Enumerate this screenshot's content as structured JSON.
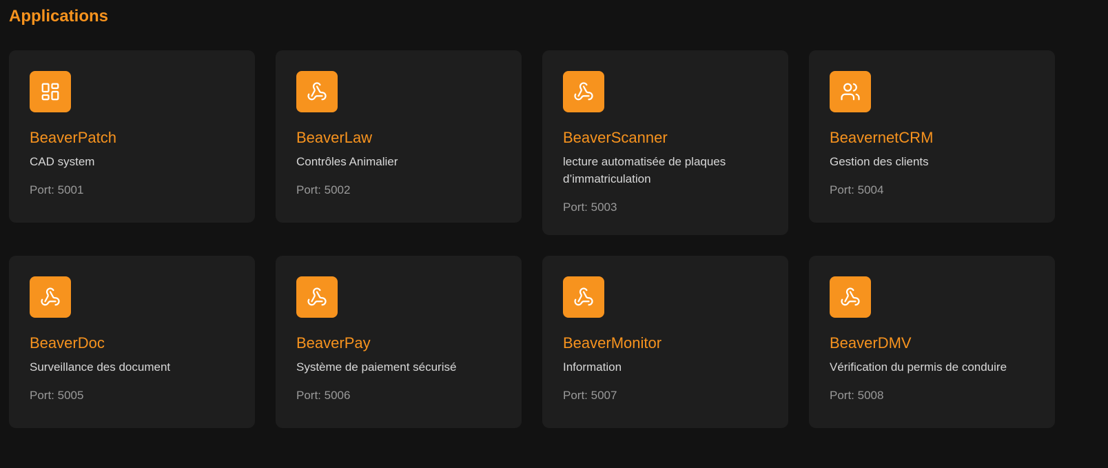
{
  "page": {
    "title": "Applications"
  },
  "colors": {
    "background": "#121212",
    "card": "#1e1e1e",
    "accent": "#f7931e",
    "description": "#d8d8d8",
    "port": "#9a9a9a"
  },
  "apps": [
    {
      "name": "BeaverPatch",
      "description": "CAD system",
      "port": "Port: 5001",
      "icon": "grid-icon"
    },
    {
      "name": "BeaverLaw",
      "description": "Contrôles Animalier",
      "port": "Port: 5002",
      "icon": "webhook-icon"
    },
    {
      "name": "BeaverScanner",
      "description": "lecture automatisée de plaques d’immatriculation",
      "port": "Port: 5003",
      "icon": "webhook-icon"
    },
    {
      "name": "BeavernetCRM",
      "description": "Gestion des clients",
      "port": "Port: 5004",
      "icon": "users-icon"
    },
    {
      "name": "BeaverDoc",
      "description": "Surveillance des document",
      "port": "Port: 5005",
      "icon": "webhook-icon"
    },
    {
      "name": "BeaverPay",
      "description": "Système de paiement sécurisé",
      "port": "Port: 5006",
      "icon": "webhook-icon"
    },
    {
      "name": "BeaverMonitor",
      "description": "Information",
      "port": "Port: 5007",
      "icon": "webhook-icon"
    },
    {
      "name": "BeaverDMV",
      "description": "Vérification du permis de conduire",
      "port": "Port: 5008",
      "icon": "webhook-icon"
    }
  ]
}
